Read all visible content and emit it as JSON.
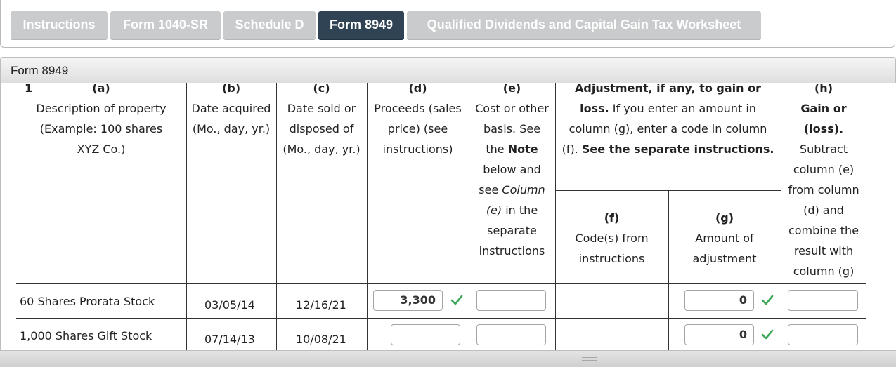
{
  "tabs": [
    {
      "label": "Instructions",
      "active": false
    },
    {
      "label": "Form 1040-SR",
      "active": false
    },
    {
      "label": "Schedule D",
      "active": false
    },
    {
      "label": "Form 8949",
      "active": true
    },
    {
      "label": "Qualified Dividends and Capital Gain Tax Worksheet",
      "active": false
    }
  ],
  "panel": {
    "title": "Form 8949"
  },
  "form": {
    "line_number": "1",
    "columns": {
      "a": {
        "letter": "(a)",
        "lines": [
          "Description of property",
          "(Example: 100 shares",
          "XYZ Co.)"
        ]
      },
      "b": {
        "letter": "(b)",
        "lines": [
          "Date acquired",
          "(Mo., day, yr.)"
        ]
      },
      "c": {
        "letter": "(c)",
        "lines": [
          "Date sold or",
          "disposed of",
          "(Mo., day, yr.)"
        ]
      },
      "d": {
        "letter": "(d)",
        "lines": [
          "Proceeds (sales",
          "price) (see",
          "instructions)"
        ]
      },
      "e": {
        "letter": "(e)",
        "lines": [
          "Cost or other",
          "basis. See",
          "the",
          "Note",
          "below and",
          "see",
          "Column",
          "(e)",
          "in the",
          "separate",
          "instructions"
        ]
      },
      "adj": {
        "bold1": "Adjustment, if any, to gain or",
        "bold2": "loss.",
        "text2": " If you enter an amount in",
        "text3": "column (g), enter a code in column",
        "text4a": "(f). ",
        "bold4": "See the separate instructions."
      },
      "f": {
        "letter": "(f)",
        "lines": [
          "Code(s) from",
          "instructions"
        ]
      },
      "g": {
        "letter": "(g)",
        "lines": [
          "Amount of",
          "adjustment"
        ]
      },
      "h": {
        "letter": "(h)",
        "bold_lines": [
          "Gain or",
          "(loss)."
        ],
        "lines": [
          "Subtract",
          "column (e)",
          "from column",
          "(d) and",
          "combine the",
          "result with",
          "column (g)"
        ]
      }
    },
    "rows": [
      {
        "description": "60 Shares Prorata Stock",
        "date_acquired": "03/05/14",
        "date_sold": "12/16/21",
        "proceeds": "3,300",
        "proceeds_checked": true,
        "cost": "",
        "adjustment": "0",
        "adjustment_checked": true,
        "gain": ""
      },
      {
        "description": "1,000 Shares Gift Stock",
        "date_acquired": "07/14/13",
        "date_sold": "10/08/21",
        "proceeds": "",
        "proceeds_checked": false,
        "cost": "",
        "adjustment": "0",
        "adjustment_checked": true,
        "gain": ""
      }
    ]
  },
  "colors": {
    "active_tab": "#2f4355",
    "inactive_tab": "#c9cbcc",
    "check": "#3aa655"
  }
}
